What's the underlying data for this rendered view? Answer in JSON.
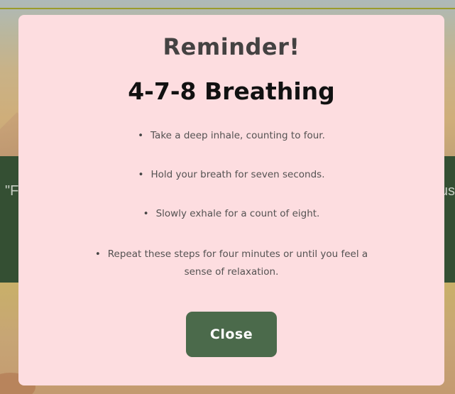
{
  "background": {
    "quote_left_fragment": "\"F",
    "quote_right_fragment": "us"
  },
  "modal": {
    "title": "Reminder!",
    "subtitle": "4-7-8 Breathing",
    "steps": [
      {
        "bullet": "•",
        "text": "Take a deep inhale, counting to four."
      },
      {
        "bullet": "•",
        "text": "Hold your breath for seven seconds."
      },
      {
        "bullet": "•",
        "text": "Slowly exhale for a count of eight."
      },
      {
        "bullet": "•",
        "text": "Repeat these steps for four minutes or until you feel a sense of relaxation."
      }
    ],
    "close_label": "Close"
  },
  "colors": {
    "modal_bg": "#fddde0",
    "button_bg": "#4b6a4b",
    "band_bg": "#344f33"
  }
}
